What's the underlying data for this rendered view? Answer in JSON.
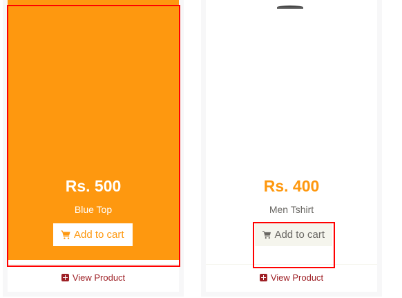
{
  "products": [
    {
      "price": "Rs. 500",
      "name": "Blue Top",
      "add_to_cart_label": "Add to cart",
      "view_product_label": "View Product",
      "state": "hover-overlay"
    },
    {
      "price": "Rs. 400",
      "name": "Men Tshirt",
      "add_to_cart_label": "Add to cart",
      "view_product_label": "View Product",
      "state": "default"
    }
  ],
  "colors": {
    "accent": "#fe980f",
    "link": "#9e2026",
    "text": "#696763",
    "highlight": "#ff0000"
  },
  "icons": [
    "shopping-cart-icon",
    "plus-square-icon"
  ]
}
